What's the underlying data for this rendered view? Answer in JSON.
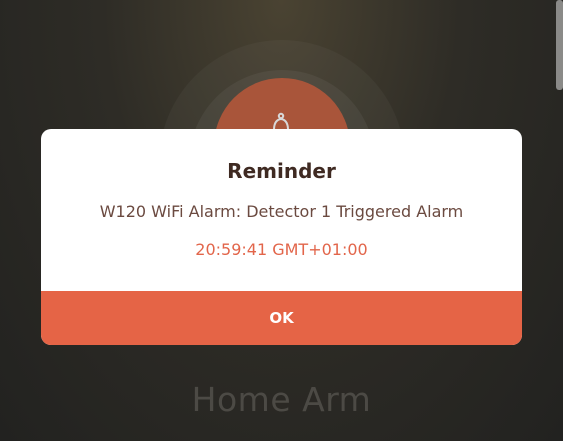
{
  "background": {
    "mode_label": "Home Arm"
  },
  "dialog": {
    "title": "Reminder",
    "message": "W120 WiFi Alarm: Detector 1 Triggered Alarm",
    "time": "20:59:41 GMT+01:00",
    "ok_label": "OK"
  },
  "colors": {
    "accent": "#e56446",
    "time_text": "#e2654a",
    "title_text": "#3f2a22"
  },
  "icons": {
    "arm_icon": "bell-icon"
  }
}
